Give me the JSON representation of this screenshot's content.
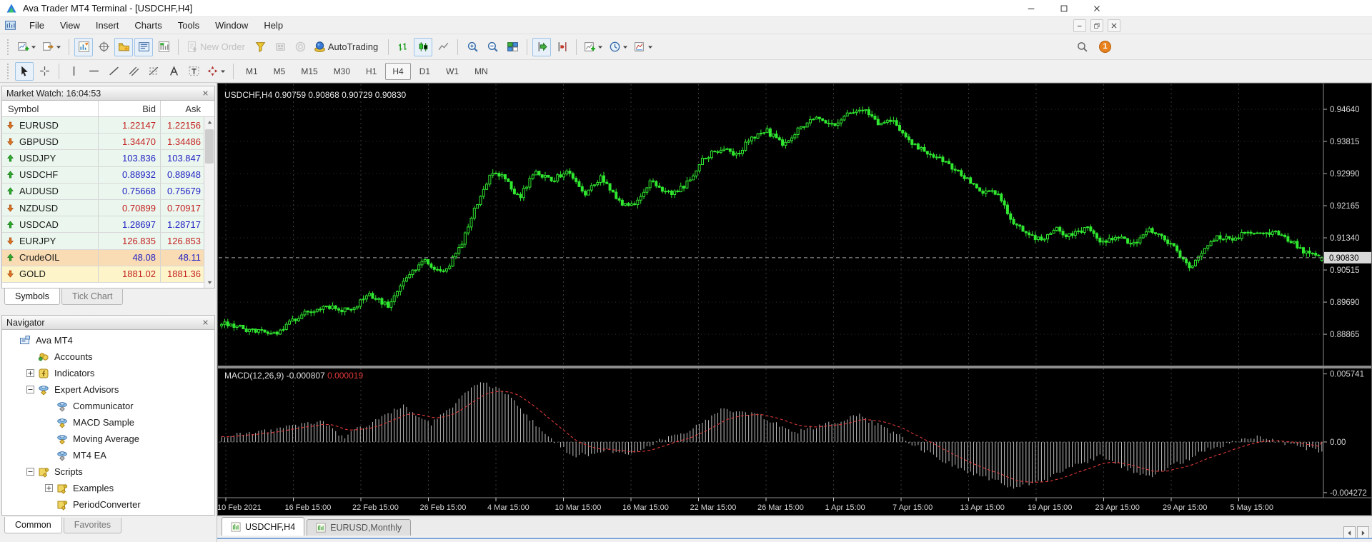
{
  "window": {
    "title": "Ava Trader MT4 Terminal - [USDCHF,H4]"
  },
  "menu": {
    "items": [
      "File",
      "View",
      "Insert",
      "Charts",
      "Tools",
      "Window",
      "Help"
    ]
  },
  "toolbar": {
    "notification_count": "1",
    "row1": [
      {
        "name": "new-chart",
        "dropdown": true
      },
      {
        "name": "open-profiles",
        "dropdown": true
      },
      {
        "sep": true
      },
      {
        "name": "market-watch",
        "active": true
      },
      {
        "name": "data-window"
      },
      {
        "name": "navigator",
        "active": true
      },
      {
        "name": "terminal",
        "active": true
      },
      {
        "name": "strategy-tester"
      },
      {
        "sep": true
      },
      {
        "name": "new-order",
        "label": "New Order",
        "disabled": true
      },
      {
        "name": "metaeditor"
      },
      {
        "name": "experts",
        "disabled": true
      },
      {
        "name": "mql5-market",
        "disabled": true
      },
      {
        "name": "autotrading",
        "label": "AutoTrading"
      },
      {
        "sep": true
      },
      {
        "name": "bar-chart"
      },
      {
        "name": "candlestick-chart",
        "active": true
      },
      {
        "name": "line-chart"
      },
      {
        "sep": true
      },
      {
        "name": "zoom-in"
      },
      {
        "name": "zoom-out"
      },
      {
        "name": "tile-windows"
      },
      {
        "sep": true
      },
      {
        "name": "auto-scroll",
        "active": true
      },
      {
        "name": "chart-shift"
      },
      {
        "sep": true
      },
      {
        "name": "indicators-list",
        "dropdown": true
      },
      {
        "name": "periods",
        "dropdown": true
      },
      {
        "name": "templates",
        "dropdown": true
      }
    ],
    "row2": [
      {
        "name": "cursor",
        "active": true
      },
      {
        "name": "crosshair"
      },
      {
        "sep": true
      },
      {
        "name": "vertical-line"
      },
      {
        "name": "horizontal-line"
      },
      {
        "name": "trendline"
      },
      {
        "name": "equidistant-channel"
      },
      {
        "name": "fibonacci"
      },
      {
        "name": "text"
      },
      {
        "name": "text-label"
      },
      {
        "name": "arrows",
        "dropdown": true
      }
    ]
  },
  "timeframes": {
    "items": [
      "M1",
      "M5",
      "M15",
      "M30",
      "H1",
      "H4",
      "D1",
      "W1",
      "MN"
    ],
    "active": "H4"
  },
  "market_watch": {
    "title": "Market Watch: 16:04:53",
    "columns": [
      "Symbol",
      "Bid",
      "Ask"
    ],
    "rows": [
      {
        "symbol": "EURUSD",
        "bid": "1.22147",
        "ask": "1.22156",
        "dir": "down",
        "bg": "fx"
      },
      {
        "symbol": "GBPUSD",
        "bid": "1.34470",
        "ask": "1.34486",
        "dir": "down",
        "bg": "fx"
      },
      {
        "symbol": "USDJPY",
        "bid": "103.836",
        "ask": "103.847",
        "dir": "up",
        "bg": "fx"
      },
      {
        "symbol": "USDCHF",
        "bid": "0.88932",
        "ask": "0.88948",
        "dir": "up",
        "bg": "fx"
      },
      {
        "symbol": "AUDUSD",
        "bid": "0.75668",
        "ask": "0.75679",
        "dir": "up",
        "bg": "fx"
      },
      {
        "symbol": "NZDUSD",
        "bid": "0.70899",
        "ask": "0.70917",
        "dir": "down",
        "bg": "fx"
      },
      {
        "symbol": "USDCAD",
        "bid": "1.28697",
        "ask": "1.28717",
        "dir": "up",
        "bg": "fx"
      },
      {
        "symbol": "EURJPY",
        "bid": "126.835",
        "ask": "126.853",
        "dir": "down",
        "bg": "fx"
      },
      {
        "symbol": "CrudeOIL",
        "bid": "48.08",
        "ask": "48.11",
        "dir": "up",
        "bg": "oil"
      },
      {
        "symbol": "GOLD",
        "bid": "1881.02",
        "ask": "1881.36",
        "dir": "down",
        "bg": "gold"
      }
    ],
    "tabs": [
      {
        "label": "Symbols",
        "active": true
      },
      {
        "label": "Tick Chart",
        "active": false
      }
    ]
  },
  "navigator": {
    "title": "Navigator",
    "tree": [
      {
        "label": "Ava MT4",
        "depth": 0,
        "icon": "terminal",
        "expander": null
      },
      {
        "label": "Accounts",
        "depth": 1,
        "icon": "accounts",
        "expander": null
      },
      {
        "label": "Indicators",
        "depth": 1,
        "icon": "indicators",
        "expander": "plus"
      },
      {
        "label": "Expert Advisors",
        "depth": 1,
        "icon": "ea",
        "expander": "minus"
      },
      {
        "label": "Communicator",
        "depth": 2,
        "icon": "ea2",
        "expander": null
      },
      {
        "label": "MACD Sample",
        "depth": 2,
        "icon": "ea",
        "expander": null
      },
      {
        "label": "Moving Average",
        "depth": 2,
        "icon": "ea",
        "expander": null
      },
      {
        "label": "MT4 EA",
        "depth": 2,
        "icon": "ea2",
        "expander": null
      },
      {
        "label": "Scripts",
        "depth": 1,
        "icon": "scripts",
        "expander": "minus"
      },
      {
        "label": "Examples",
        "depth": 2,
        "icon": "scripts",
        "expander": "plus"
      },
      {
        "label": "PeriodConverter",
        "depth": 2,
        "icon": "scripts",
        "expander": null
      }
    ],
    "tabs": [
      {
        "label": "Common",
        "active": true
      },
      {
        "label": "Favorites",
        "active": false
      }
    ]
  },
  "chart_tabs": [
    {
      "label": "USDCHF,H4",
      "active": true
    },
    {
      "label": "EURUSD,Monthly",
      "active": false
    }
  ],
  "chart_data": {
    "type": "candlestick",
    "symbol": "USDCHF",
    "timeframe": "H4",
    "legend": "USDCHF,H4",
    "ohlc": {
      "open": "0.90759",
      "high": "0.90868",
      "low": "0.90729",
      "close": "0.90830"
    },
    "current_price": {
      "value": 0.9083,
      "label": "0.90830"
    },
    "price_axis": {
      "min": 0.8806,
      "max": 0.95282,
      "ticks": [
        {
          "value": 0.9464,
          "label": "0.94640"
        },
        {
          "value": 0.93815,
          "label": "0.93815"
        },
        {
          "value": 0.9299,
          "label": "0.92990"
        },
        {
          "value": 0.92165,
          "label": "0.92165"
        },
        {
          "value": 0.9134,
          "label": "0.91340"
        },
        {
          "value": 0.90515,
          "label": "0.90515"
        },
        {
          "value": 0.8969,
          "label": "0.89690"
        },
        {
          "value": 0.88865,
          "label": "0.88865"
        }
      ]
    },
    "x_axis": {
      "labels": [
        "10 Feb 2021",
        "16 Feb 15:00",
        "22 Feb 15:00",
        "26 Feb 15:00",
        "4 Mar 15:00",
        "10 Mar 15:00",
        "16 Mar 15:00",
        "22 Mar 15:00",
        "26 Mar 15:00",
        "1 Apr 15:00",
        "7 Apr 15:00",
        "13 Apr 15:00",
        "19 Apr 15:00",
        "23 Apr 15:00",
        "29 Apr 15:00",
        "5 May 15:00"
      ]
    },
    "num_candles": 358,
    "price_path": [
      [
        0.0,
        0.8916
      ],
      [
        0.025,
        0.8898
      ],
      [
        0.048,
        0.8887
      ],
      [
        0.075,
        0.8943
      ],
      [
        0.095,
        0.8961
      ],
      [
        0.115,
        0.8947
      ],
      [
        0.135,
        0.8989
      ],
      [
        0.152,
        0.8958
      ],
      [
        0.17,
        0.9042
      ],
      [
        0.185,
        0.9078
      ],
      [
        0.2,
        0.904
      ],
      [
        0.215,
        0.9098
      ],
      [
        0.232,
        0.922
      ],
      [
        0.245,
        0.9305
      ],
      [
        0.258,
        0.9285
      ],
      [
        0.27,
        0.9235
      ],
      [
        0.285,
        0.9308
      ],
      [
        0.3,
        0.928
      ],
      [
        0.315,
        0.9306
      ],
      [
        0.33,
        0.9248
      ],
      [
        0.345,
        0.929
      ],
      [
        0.362,
        0.9222
      ],
      [
        0.375,
        0.9215
      ],
      [
        0.39,
        0.9282
      ],
      [
        0.405,
        0.9248
      ],
      [
        0.42,
        0.9262
      ],
      [
        0.438,
        0.934
      ],
      [
        0.455,
        0.9365
      ],
      [
        0.468,
        0.9348
      ],
      [
        0.482,
        0.9392
      ],
      [
        0.495,
        0.941
      ],
      [
        0.51,
        0.9372
      ],
      [
        0.525,
        0.9418
      ],
      [
        0.542,
        0.944
      ],
      [
        0.556,
        0.9422
      ],
      [
        0.57,
        0.9452
      ],
      [
        0.583,
        0.9465
      ],
      [
        0.597,
        0.9425
      ],
      [
        0.61,
        0.9432
      ],
      [
        0.625,
        0.9385
      ],
      [
        0.64,
        0.9352
      ],
      [
        0.655,
        0.9335
      ],
      [
        0.67,
        0.9302
      ],
      [
        0.683,
        0.9272
      ],
      [
        0.695,
        0.9248
      ],
      [
        0.706,
        0.9252
      ],
      [
        0.716,
        0.9185
      ],
      [
        0.73,
        0.9148
      ],
      [
        0.744,
        0.913
      ],
      [
        0.758,
        0.9156
      ],
      [
        0.772,
        0.9138
      ],
      [
        0.786,
        0.9162
      ],
      [
        0.8,
        0.9122
      ],
      [
        0.814,
        0.9138
      ],
      [
        0.828,
        0.9112
      ],
      [
        0.842,
        0.9158
      ],
      [
        0.855,
        0.9132
      ],
      [
        0.868,
        0.9102
      ],
      [
        0.88,
        0.9062
      ],
      [
        0.892,
        0.9096
      ],
      [
        0.905,
        0.914
      ],
      [
        0.918,
        0.9128
      ],
      [
        0.932,
        0.9152
      ],
      [
        0.946,
        0.9142
      ],
      [
        0.96,
        0.915
      ],
      [
        0.975,
        0.9118
      ],
      [
        0.988,
        0.9092
      ],
      [
        1.0,
        0.9083
      ]
    ],
    "indicator": {
      "name": "MACD",
      "label": "MACD(12,26,9)",
      "value": "-0.000807",
      "signal": "0.000019",
      "range": {
        "min": -0.0047,
        "max": 0.0062
      },
      "axis_ticks": [
        {
          "value": 0.005741,
          "label": "0.005741"
        },
        {
          "value": 0,
          "label": "0.00"
        },
        {
          "value": -0.004272,
          "label": "-0.004272"
        }
      ],
      "path": [
        [
          0.0,
          0.0004
        ],
        [
          0.04,
          0.0009
        ],
        [
          0.07,
          0.0014
        ],
        [
          0.09,
          0.0018
        ],
        [
          0.11,
          0.0004
        ],
        [
          0.13,
          0.0014
        ],
        [
          0.165,
          0.003
        ],
        [
          0.19,
          0.0015
        ],
        [
          0.21,
          0.003
        ],
        [
          0.235,
          0.0052
        ],
        [
          0.26,
          0.004
        ],
        [
          0.29,
          0.001
        ],
        [
          0.32,
          -0.0012
        ],
        [
          0.35,
          -0.0008
        ],
        [
          0.37,
          -0.001
        ],
        [
          0.4,
          0.0002
        ],
        [
          0.43,
          0.0012
        ],
        [
          0.455,
          0.0028
        ],
        [
          0.49,
          0.0022
        ],
        [
          0.52,
          0.0008
        ],
        [
          0.55,
          0.0015
        ],
        [
          0.58,
          0.0022
        ],
        [
          0.61,
          0.0008
        ],
        [
          0.64,
          -0.0008
        ],
        [
          0.67,
          -0.0022
        ],
        [
          0.7,
          -0.0032
        ],
        [
          0.72,
          -0.0038
        ],
        [
          0.75,
          -0.0032
        ],
        [
          0.78,
          -0.0018
        ],
        [
          0.8,
          -0.0012
        ],
        [
          0.84,
          -0.003
        ],
        [
          0.87,
          -0.0018
        ],
        [
          0.9,
          -0.0005
        ],
        [
          0.94,
          0.0004
        ],
        [
          0.97,
          -0.0002
        ],
        [
          1.0,
          -0.0008
        ]
      ]
    },
    "colors": {
      "background": "#000000",
      "grid": "#3a3a3a",
      "candle": "#30e830",
      "histogram": "#c0c0c0",
      "signal": "#e03838",
      "axis_text": "#d6d6d6",
      "price_line": "#a8a8a8"
    }
  }
}
